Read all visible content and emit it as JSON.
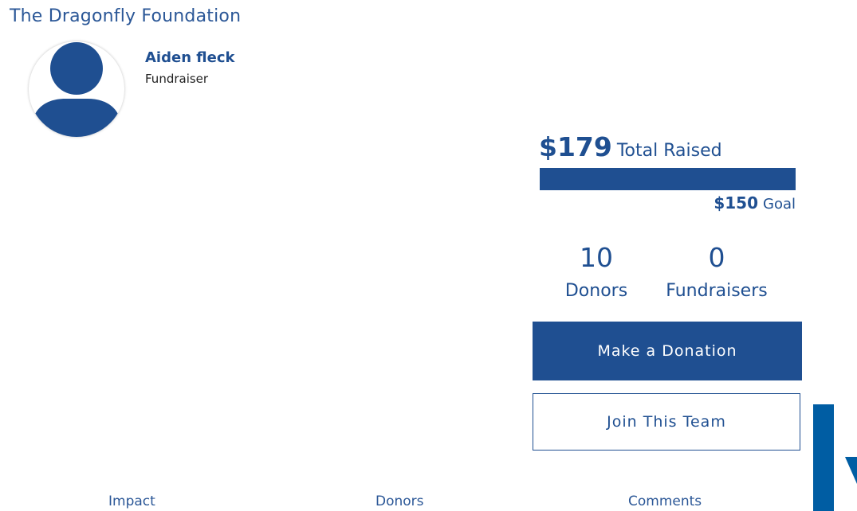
{
  "organization": {
    "name": "The Dragonfly Foundation"
  },
  "fundraiser": {
    "name": "Aiden fleck",
    "role": "Fundraiser"
  },
  "totals": {
    "raised_amount": "$179",
    "raised_label": "Total Raised",
    "goal_amount": "$150",
    "goal_label": "Goal",
    "progress_percent": 100
  },
  "stats": {
    "donors": {
      "count": "10",
      "label": "Donors"
    },
    "fundraisers": {
      "count": "0",
      "label": "Fundraisers"
    }
  },
  "actions": {
    "donate_label": "Make a Donation",
    "join_label": "Join This Team"
  },
  "tabs": [
    {
      "label": "Impact"
    },
    {
      "label": "Donors"
    },
    {
      "label": "Comments"
    }
  ],
  "colors": {
    "brand": "#1f4f91",
    "logo_blue": "#005da3"
  },
  "icons": {
    "avatar": "user-silhouette-icon"
  }
}
